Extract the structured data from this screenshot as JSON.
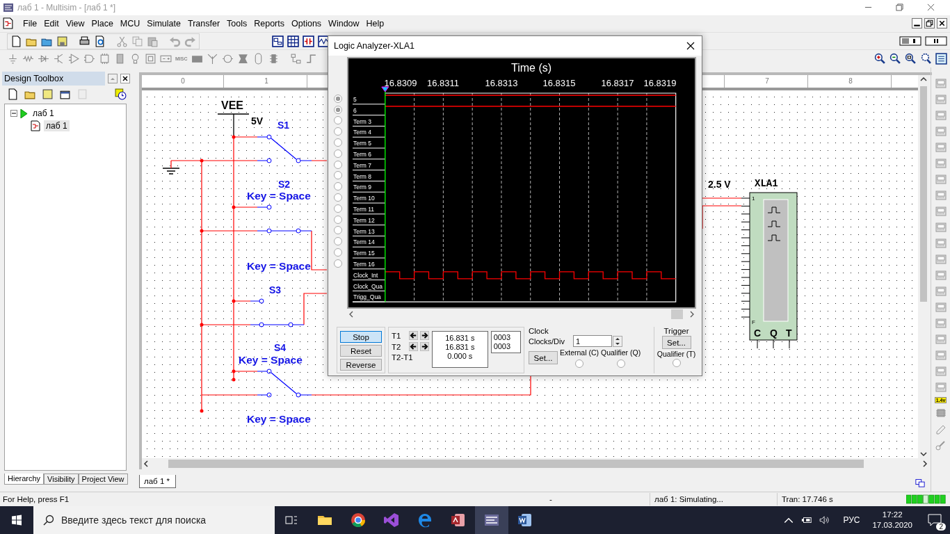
{
  "window": {
    "title": "лаб 1 - Multisim - [лаб 1 *]"
  },
  "menu": [
    "File",
    "Edit",
    "View",
    "Place",
    "MCU",
    "Simulate",
    "Transfer",
    "Tools",
    "Reports",
    "Options",
    "Window",
    "Help"
  ],
  "toolbar": {
    "misc_label": "MISC"
  },
  "design_toolbox": {
    "title": "Design Toolbox",
    "tree": [
      {
        "label": "лаб 1",
        "expanded": true,
        "children": [
          {
            "label": "лаб 1",
            "selected": true
          }
        ]
      }
    ],
    "tabs": [
      {
        "label": "Hierarchy",
        "selected": true
      },
      {
        "label": "Visibility",
        "selected": false
      },
      {
        "label": "Project View",
        "selected": false
      }
    ]
  },
  "ruler": [
    "0",
    "1",
    "7",
    "8"
  ],
  "schematic": {
    "labels": [
      {
        "text": "VEE",
        "kind": "net"
      },
      {
        "text": "5V",
        "kind": "value"
      },
      {
        "text": "S1",
        "kind": "ref"
      },
      {
        "text": "S2",
        "kind": "ref"
      },
      {
        "text": "Key = Space",
        "kind": "key"
      },
      {
        "text": "Key = Space",
        "kind": "key"
      },
      {
        "text": "S3",
        "kind": "ref"
      },
      {
        "text": "S4",
        "kind": "ref"
      },
      {
        "text": "Key = Space",
        "kind": "key"
      },
      {
        "text": "Key = Space",
        "kind": "key"
      },
      {
        "text": "2.5 V",
        "kind": "value"
      }
    ],
    "instrument": {
      "name": "XLA1",
      "pins": [
        "1",
        "F"
      ],
      "terminals": [
        "C",
        "Q",
        "T"
      ]
    }
  },
  "document_tabs": [
    {
      "label": "лаб 1 *",
      "selected": true
    }
  ],
  "instruments_toolbar": {
    "probe_label": "1.4v"
  },
  "logic_analyzer": {
    "title": "Logic Analyzer-XLA1",
    "axis_title": "Time (s)",
    "time_ticks": [
      "16.8309",
      "16.8311",
      "16.8313",
      "16.8315",
      "16.8317",
      "16.8319"
    ],
    "channels": [
      {
        "name": "5",
        "kind": "input",
        "connected": true,
        "signal": true
      },
      {
        "name": "6",
        "kind": "input",
        "connected": true,
        "signal": true
      },
      {
        "name": "Term 3",
        "kind": "input",
        "connected": false,
        "signal": false
      },
      {
        "name": "Term 4",
        "kind": "input",
        "connected": false,
        "signal": false
      },
      {
        "name": "Term 5",
        "kind": "input",
        "connected": false,
        "signal": false
      },
      {
        "name": "Term 6",
        "kind": "input",
        "connected": false,
        "signal": false
      },
      {
        "name": "Term 7",
        "kind": "input",
        "connected": false,
        "signal": false
      },
      {
        "name": "Term 8",
        "kind": "input",
        "connected": false,
        "signal": false
      },
      {
        "name": "Term 9",
        "kind": "input",
        "connected": false,
        "signal": false
      },
      {
        "name": "Term 10",
        "kind": "input",
        "connected": false,
        "signal": false
      },
      {
        "name": "Term 11",
        "kind": "input",
        "connected": false,
        "signal": false
      },
      {
        "name": "Term 12",
        "kind": "input",
        "connected": false,
        "signal": false
      },
      {
        "name": "Term 13",
        "kind": "input",
        "connected": false,
        "signal": false
      },
      {
        "name": "Term 14",
        "kind": "input",
        "connected": false,
        "signal": false
      },
      {
        "name": "Term 15",
        "kind": "input",
        "connected": false,
        "signal": false
      },
      {
        "name": "Term 16",
        "kind": "input",
        "connected": false,
        "signal": false
      },
      {
        "name": "Clock_Int",
        "kind": "clock",
        "signal": true
      },
      {
        "name": "Clock_Qua",
        "kind": "clock",
        "signal": false
      },
      {
        "name": "Trigg_Qua",
        "kind": "clock",
        "signal": false
      }
    ],
    "buttons": [
      {
        "label": "Stop",
        "selected": true
      },
      {
        "label": "Reset",
        "selected": false
      },
      {
        "label": "Reverse",
        "selected": false
      }
    ],
    "cursors": [
      "T1",
      "T2"
    ],
    "difference_label": "T2-T1",
    "readout": [
      "16.831 s",
      "16.831 s",
      "0.000 s"
    ],
    "values": [
      "0003",
      "0003"
    ],
    "clock": {
      "title": "Clock",
      "clocks_per_div_label": "Clocks/Div",
      "clocks_per_div": "1",
      "set": "Set...",
      "external": {
        "label": "External (C)",
        "selected": false
      },
      "qualifier": {
        "label": "Qualifier (Q)",
        "selected": false
      }
    },
    "trigger": {
      "title": "Trigger",
      "set": "Set...",
      "qualifier": {
        "label": "Qualifier (T)",
        "selected": false
      }
    }
  },
  "status_bar": {
    "help": "For Help, press F1",
    "field_2": "-",
    "simulation": "лаб 1: Simulating...",
    "transient": "Tran: 17.746 s"
  },
  "taskbar": {
    "search_placeholder": "Введите здесь текст для поиска",
    "apps": [
      {
        "kind": "files",
        "active": false
      },
      {
        "kind": "chrome",
        "active": false
      },
      {
        "kind": "studio",
        "active": false
      },
      {
        "kind": "edge",
        "active": false
      },
      {
        "kind": "access",
        "active": false
      },
      {
        "kind": "multisim",
        "active": true
      },
      {
        "kind": "word",
        "active": false
      }
    ],
    "language": "РУС",
    "time": "17:22",
    "date": "17.03.2020",
    "notifications": "2"
  }
}
